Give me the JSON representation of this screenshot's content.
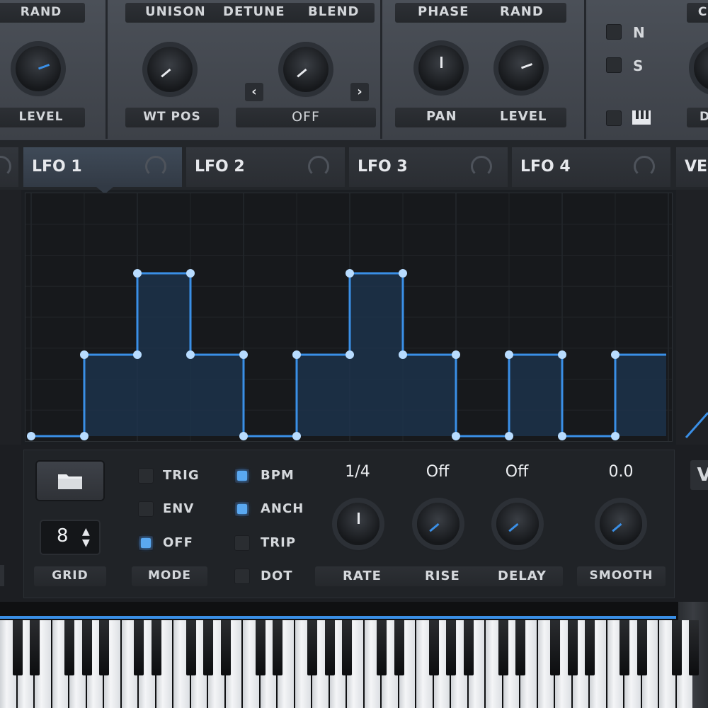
{
  "osc_panel": {
    "rand_label": "RAND",
    "level_label": "LEVEL",
    "unison_label": "UNISON",
    "detune_label": "DETUNE",
    "blend_label": "BLEND",
    "wt_pos_label": "WT POS",
    "warp_value": "OFF",
    "phase_label": "PHASE",
    "rand2_label": "RAND",
    "pan_label": "PAN",
    "level2_label": "LEVEL",
    "n_label": "N",
    "s_label": "S",
    "cu_label": "CU",
    "d_label": "D"
  },
  "tabs": [
    {
      "label": "LFO 1"
    },
    {
      "label": "LFO 2"
    },
    {
      "label": "LFO 3"
    },
    {
      "label": "LFO 4"
    },
    {
      "label": "VE"
    }
  ],
  "lfo_shape": {
    "steps": [
      0,
      1,
      2,
      1,
      0,
      1,
      2,
      1,
      0,
      1,
      0,
      1,
      1
    ],
    "max_level": 2,
    "line_color": "#3a8fe6",
    "point_color": "#b8dcff"
  },
  "controls": {
    "grid_value": "8",
    "grid_label": "GRID",
    "mode_label": "MODE",
    "trig_label": "TRIG",
    "env_label": "ENV",
    "off_label": "OFF",
    "bpm_label": "BPM",
    "anch_label": "ANCH",
    "trip_label": "TRIP",
    "dot_label": "DOT",
    "rate_value": "1/4",
    "rise_value": "Off",
    "delay_value": "Off",
    "smooth_value": "0.0",
    "rate_label": "RATE",
    "rise_label": "RISE",
    "delay_label": "DELAY",
    "smooth_label": "SMOOTH",
    "vel_label": "V"
  },
  "colors": {
    "accent": "#3a8fe6",
    "panel": "#43474e",
    "background": "#1b1e22"
  }
}
